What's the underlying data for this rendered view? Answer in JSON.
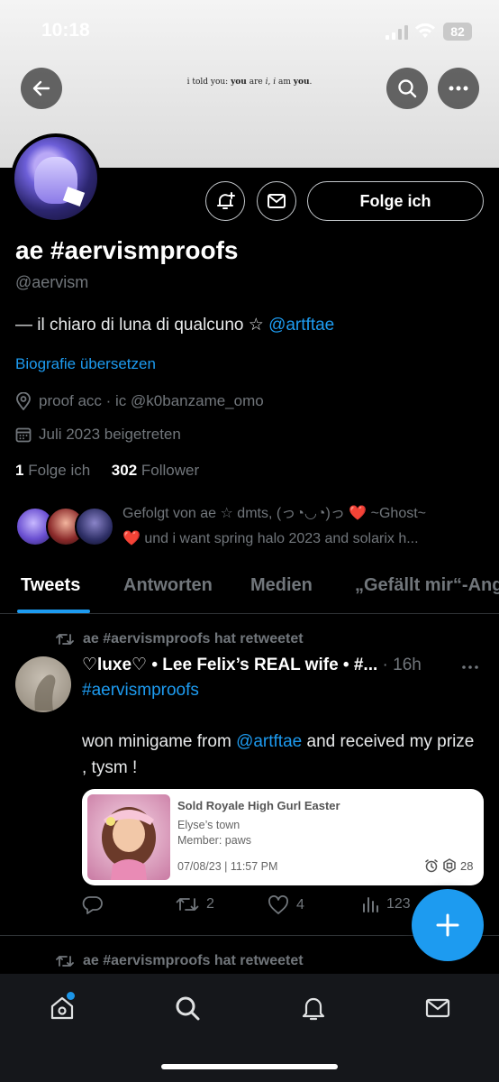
{
  "status_bar": {
    "time": "10:18",
    "battery": "82"
  },
  "banner": {
    "text_plain1": "i told you: ",
    "text_bold1": "you",
    "text_plain2": " are ",
    "text_italic1": "i",
    "text_plain3": ", ",
    "text_italic2": "i",
    "text_plain4": " am ",
    "text_bold2": "you",
    "text_plain5": "."
  },
  "profile": {
    "name": "ae #aervismproofs",
    "handle": "@aervism",
    "bio_text": "— il chiaro di luna di qualcuno ☆ ",
    "bio_mention": "@artftae",
    "translate": "Biografie übersetzen",
    "location": "proof acc · ic @k0banzame_omo",
    "joined": "Juli 2023 beigetreten",
    "following_count": "1",
    "following_label": " Folge ich",
    "followers_count": "302",
    "followers_label": " Follower",
    "follow_button": "Folge ich",
    "followed_by_line1": "Gefolgt von ae ☆ dmts, (っ◔◡◔)っ ",
    "followed_by_line1_end": " ~Ghost~",
    "followed_by_line2": " und i want spring halo 2023 and solarix h..."
  },
  "tabs": [
    "Tweets",
    "Antworten",
    "Medien",
    "„Gefällt mir“-Angaben"
  ],
  "tweet": {
    "retweet_label": "ae #aervismproofs hat retweetet",
    "author": "♡luxe♡ • Lee Felix’s REAL wife • #...",
    "time": " · 16h",
    "hashtag": "#aervismproofs",
    "body_pre": "won minigame from ",
    "body_mention": "@artftae",
    "body_post": " and received my prize , tysm !",
    "card": {
      "title": "Sold Royale High Gurl Easter",
      "line1": "Elyse’s town",
      "line2": "Member: paws",
      "date": "07/08/23 | 11:57 PM",
      "price": "28"
    },
    "actions": {
      "replies": "",
      "retweets": "2",
      "likes": "4",
      "views": "123"
    }
  },
  "next_retweet_label": "ae #aervismproofs hat retweetet",
  "colors": {
    "accent": "#1d9bf0",
    "background": "#000000",
    "secondary_text": "#71767b",
    "heart": "#e0245e"
  }
}
